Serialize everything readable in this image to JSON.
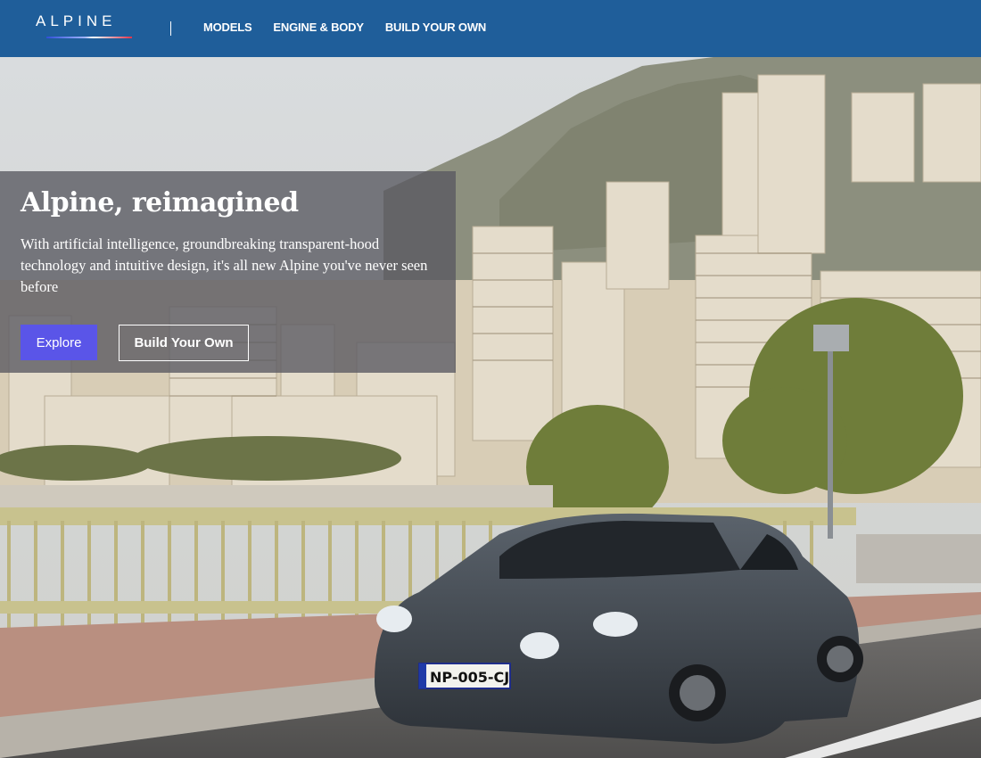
{
  "header": {
    "logo_text": "ALPINE",
    "nav": [
      {
        "label": "MODELS"
      },
      {
        "label": "ENGINE & BODY"
      },
      {
        "label": "BUILD YOUR OWN"
      }
    ]
  },
  "hero": {
    "title": "Alpine, reimagined",
    "text": "With artificial intelligence, groundbreaking transparent-hood technology and intuitive design, it's all new Alpine you've never seen before",
    "primary_button": "Explore",
    "secondary_button": "Build Your Own",
    "image": {
      "scene": "hillside city with apartment buildings",
      "car_plate": "NP-005-CJ"
    }
  },
  "colors": {
    "header_bg": "#1f5e9a",
    "primary_button": "#5a55e8",
    "panel_overlay": "rgba(88,88,96,0.78)"
  }
}
